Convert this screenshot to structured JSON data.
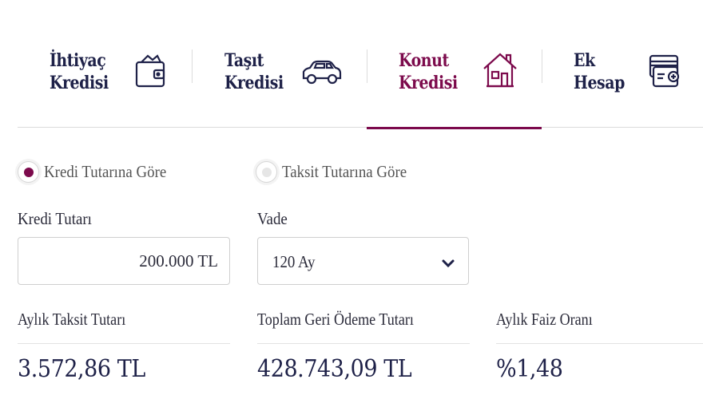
{
  "tabs": [
    {
      "line1": "İhtiyaç",
      "line2": "Kredisi",
      "icon": "wallet-icon",
      "active": false
    },
    {
      "line1": "Taşıt",
      "line2": "Kredisi",
      "icon": "car-icon",
      "active": false
    },
    {
      "line1": "Konut",
      "line2": "Kredisi",
      "icon": "house-icon",
      "active": true
    },
    {
      "line1": "Ek",
      "line2": "Hesap",
      "icon": "card-plus-icon",
      "active": false
    }
  ],
  "calc_mode": {
    "option1": "Kredi Tutarına Göre",
    "option2": "Taksit Tutarına Göre",
    "selected": "option1"
  },
  "form": {
    "amount_label": "Kredi Tutarı",
    "amount_value": "200.000 TL",
    "term_label": "Vade",
    "term_value": "120 Ay"
  },
  "results": {
    "monthly_label": "Aylık Taksit Tutarı",
    "monthly_value": "3.572,86 TL",
    "total_label": "Toplam Geri Ödeme Tutarı",
    "total_value": "428.743,09 TL",
    "rate_label": "Aylık Faiz Oranı",
    "rate_value": "%1,48"
  },
  "colors": {
    "accent": "#7c0a4c",
    "navy": "#1e2148"
  }
}
